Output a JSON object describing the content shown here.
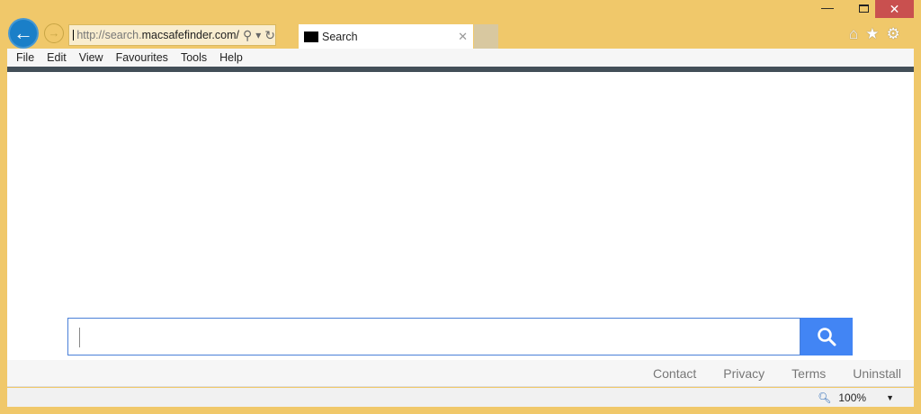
{
  "window": {
    "close": "✕",
    "minimize": "—"
  },
  "nav": {
    "back": "←",
    "forward": "→"
  },
  "address": {
    "url_prefix": "http://search.",
    "url_domain": "macsafefinder.com/",
    "search_icon": "⚲",
    "dropdown": "▾",
    "refresh": "↻"
  },
  "tab": {
    "title": "Search",
    "close": "✕"
  },
  "toolbar": {
    "home": "⌂",
    "favorites": "★",
    "settings": "⚙"
  },
  "menu": [
    "File",
    "Edit",
    "View",
    "Favourites",
    "Tools",
    "Help"
  ],
  "search": {
    "value": ""
  },
  "footer": {
    "links": [
      "Contact",
      "Privacy",
      "Terms",
      "Uninstall"
    ]
  },
  "status": {
    "zoom": "100%"
  },
  "colors": {
    "frame": "#f0c86a",
    "accent": "#4285f4",
    "close": "#c9504f"
  }
}
